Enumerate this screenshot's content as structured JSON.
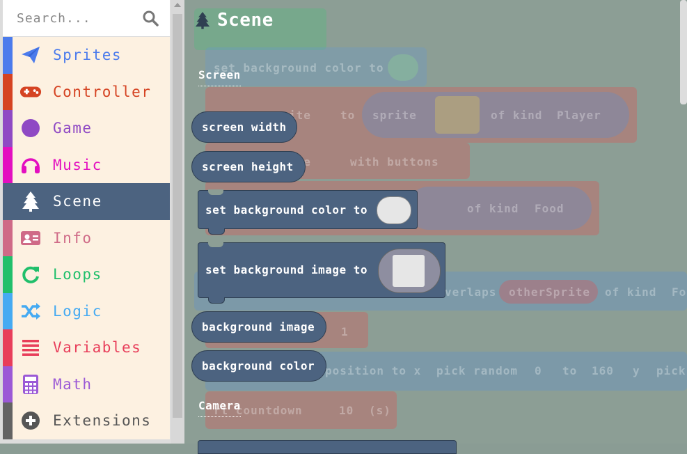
{
  "search": {
    "placeholder": "Search..."
  },
  "categories": [
    {
      "label": "Sprites",
      "color": "#4b7bec",
      "icon": "paper-plane-icon"
    },
    {
      "label": "Controller",
      "color": "#d54322",
      "icon": "gamepad-icon"
    },
    {
      "label": "Game",
      "color": "#8f49c4",
      "icon": "circle-icon"
    },
    {
      "label": "Music",
      "color": "#e30fc0",
      "icon": "headphones-icon"
    },
    {
      "label": "Scene",
      "color": "#4c6380",
      "icon": "tree-icon",
      "selected": true
    },
    {
      "label": "Info",
      "color": "#cf6a87",
      "icon": "id-card-icon"
    },
    {
      "label": "Loops",
      "color": "#20bf6b",
      "icon": "loop-icon"
    },
    {
      "label": "Logic",
      "color": "#45aaf2",
      "icon": "shuffle-icon"
    },
    {
      "label": "Variables",
      "color": "#e83e5a",
      "icon": "list-icon"
    },
    {
      "label": "Math",
      "color": "#9b59d6",
      "icon": "calculator-icon"
    },
    {
      "label": "Extensions",
      "color": "#636363",
      "icon": "plus-circle-icon"
    }
  ],
  "flyout": {
    "title": "Scene",
    "section_screen": "Screen",
    "section_camera": "Camera",
    "blocks": {
      "screen_width": "screen width",
      "screen_height": "screen height",
      "set_bg_color": "set background color to",
      "set_bg_image": "set background image to",
      "background_image": "background image",
      "background_color": "background color"
    }
  },
  "workspace": {
    "ghost_texts": {
      "set_bg": "set background color to",
      "ite": "ite",
      "to": "to",
      "sprite": "sprite",
      "of_kind_1": "of kind",
      "player": "Player",
      "ite2": "ite",
      "with_buttons": "with buttons",
      "of_kind_2": "of kind",
      "food": "Food",
      "verlaps": "verlaps",
      "other_sprite": "otherSprite",
      "of_kind_3": "of kind",
      "fo": "Fo",
      "one": "1",
      "position_to_x": "position to x",
      "pick_random": "pick random",
      "zero": "0",
      "to2": "to",
      "one_sixty": "160",
      "y": "y",
      "pick": "pick",
      "countdown": "rt countdown",
      "ten": "10",
      "s": "(s)"
    }
  }
}
